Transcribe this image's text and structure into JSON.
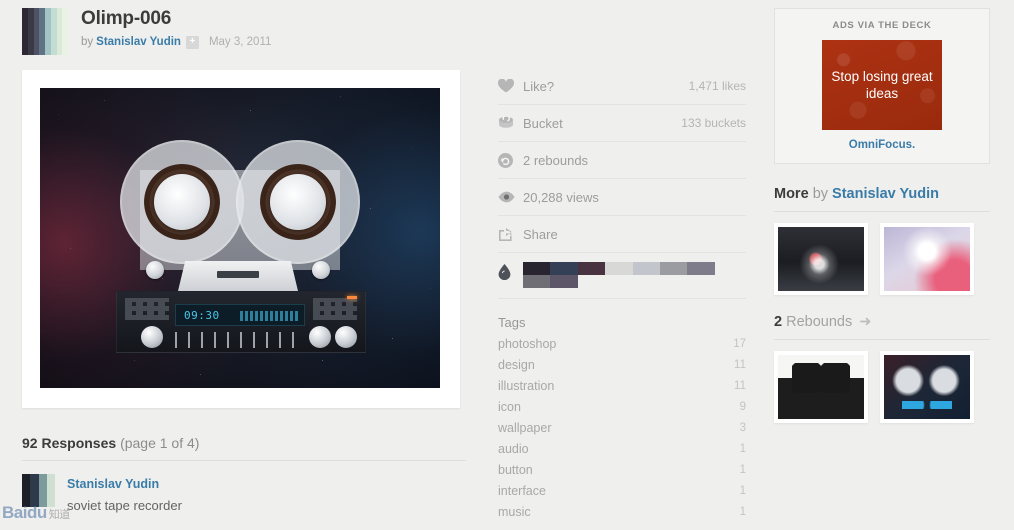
{
  "shot": {
    "title": "Olimp-006",
    "by_label": "by",
    "author": "Stanislav Yudin",
    "follow_symbol": "+",
    "date": "May 3, 2011",
    "palette_block": [
      "#2d2833",
      "#3a3a47",
      "#4d5265",
      "#5f7385",
      "#a4c4c4",
      "#c3ddd2",
      "#dbead8",
      "#e9f2e4"
    ],
    "image_alt": "Olimp-006 soviet reel-to-reel tape recorder illustration",
    "lcd_time": "09:30"
  },
  "stats": {
    "rows": [
      {
        "icon": "heart-icon",
        "label": "Like?",
        "value": "1,471 likes"
      },
      {
        "icon": "bucket-icon",
        "label": "Bucket",
        "value": "133 buckets"
      },
      {
        "icon": "rebound-icon",
        "label": "2 rebounds",
        "value": ""
      },
      {
        "icon": "eye-icon",
        "label": "20,288 views",
        "value": ""
      },
      {
        "icon": "share-icon",
        "label": "Share",
        "value": ""
      }
    ],
    "palette_icon": "droplet-icon",
    "palette_colors": [
      "#282430",
      "#334055",
      "#4a3340",
      "#d8d8d6",
      "#c2c5cb",
      "#9b9ba2",
      "#7e7c8b",
      "#6e6e74",
      "#5d5668"
    ]
  },
  "tags": {
    "title": "Tags",
    "items": [
      {
        "label": "photoshop",
        "count": "17"
      },
      {
        "label": "design",
        "count": "11"
      },
      {
        "label": "illustration",
        "count": "11"
      },
      {
        "label": "icon",
        "count": "9"
      },
      {
        "label": "wallpaper",
        "count": "3"
      },
      {
        "label": "audio",
        "count": "1"
      },
      {
        "label": "button",
        "count": "1"
      },
      {
        "label": "interface",
        "count": "1"
      },
      {
        "label": "music",
        "count": "1"
      }
    ]
  },
  "ad": {
    "label": "ADS VIA THE DECK",
    "creative_text": "Stop losing great ideas",
    "link": "OmniFocus.",
    "creative_color": "#a32d10"
  },
  "more": {
    "prefix": "More",
    "by_label": "by",
    "author": "Stanislav Yudin",
    "thumbs": [
      {
        "name": "more-thumb-1",
        "class": "pic-1"
      },
      {
        "name": "more-thumb-2",
        "class": "pic-2"
      }
    ]
  },
  "rebounds": {
    "count": "2",
    "label": "Rebounds",
    "arrow": "➜",
    "thumbs": [
      {
        "name": "rebound-thumb-1",
        "class": "pic-3"
      },
      {
        "name": "rebound-thumb-2",
        "class": "pic-4"
      }
    ]
  },
  "responses": {
    "count_label": "92 Responses",
    "page_label": "(page 1 of 4)",
    "comments": [
      {
        "author": "Stanislav Yudin",
        "text": "soviet tape recorder",
        "avatar_colors": [
          "#1d1f26",
          "#2e3a4a",
          "#7d9a9c",
          "#cfe0d2"
        ]
      }
    ]
  },
  "watermark": {
    "main": "Baidu",
    "sub": "知道"
  },
  "theme": {
    "page_bg": "#efefee",
    "link": "#3a7ca8",
    "text_dark": "#3c3c3c",
    "text_muted": "#9d9d9d"
  }
}
